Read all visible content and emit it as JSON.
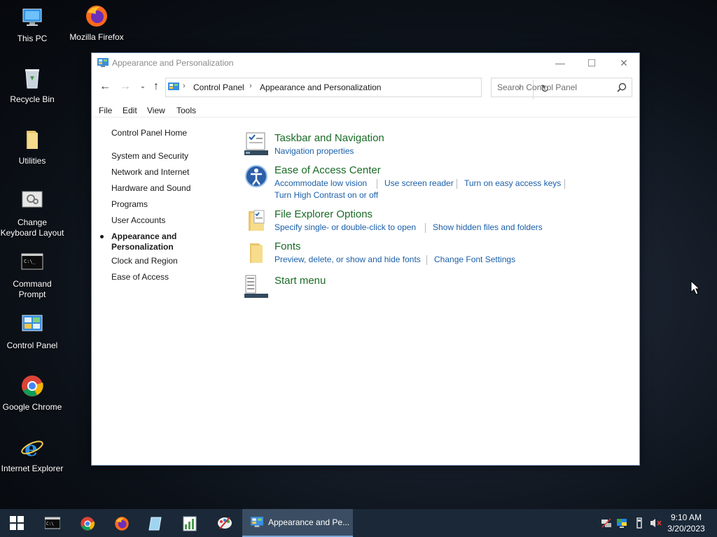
{
  "desktop": {
    "icons": [
      {
        "label": "This PC"
      },
      {
        "label": "Mozilla Firefox"
      },
      {
        "label": "Recycle Bin"
      },
      {
        "label": "Utilities"
      },
      {
        "label": "Change Keyboard Layout"
      },
      {
        "label": "Command Prompt"
      },
      {
        "label": "Control Panel"
      },
      {
        "label": "Google Chrome"
      },
      {
        "label": "Internet Explorer"
      }
    ]
  },
  "window": {
    "title": "Appearance and Personalization",
    "breadcrumb": [
      "Control Panel",
      "Appearance and Personalization"
    ],
    "search_placeholder": "Search Control Panel",
    "menu": [
      "File",
      "Edit",
      "View",
      "Tools"
    ],
    "controls": {
      "minimize": "—",
      "maximize": "☐",
      "close": "✕"
    }
  },
  "left_nav": {
    "home": "Control Panel Home",
    "items": [
      {
        "label": "System and Security"
      },
      {
        "label": "Network and Internet"
      },
      {
        "label": "Hardware and Sound"
      },
      {
        "label": "Programs"
      },
      {
        "label": "User Accounts"
      },
      {
        "label": "Appearance and Personalization",
        "line1": "Appearance and",
        "line2": "Personalization",
        "active": true
      },
      {
        "label": "Clock and Region"
      },
      {
        "label": "Ease of Access"
      }
    ]
  },
  "categories": [
    {
      "title": "Taskbar and Navigation",
      "icon": "taskbar-icon",
      "links": [
        "Navigation properties"
      ]
    },
    {
      "title": "Ease of Access Center",
      "icon": "ease-of-access-icon",
      "links": [
        "Accommodate low vision",
        "Use screen reader",
        "Turn on easy access keys",
        "Turn High Contrast on or off"
      ]
    },
    {
      "title": "File Explorer Options",
      "icon": "folder-options-icon",
      "links": [
        "Specify single- or double-click to open",
        "Show hidden files and folders"
      ]
    },
    {
      "title": "Fonts",
      "icon": "fonts-folder-icon",
      "links": [
        "Preview, delete, or show and hide fonts",
        "Change Font Settings"
      ]
    },
    {
      "title": "Start menu",
      "icon": "start-menu-icon",
      "links": []
    }
  ],
  "taskbar": {
    "active_window_label": "Appearance and Pe...",
    "pinned": [
      "start-icon",
      "command-prompt-icon",
      "chrome-icon",
      "firefox-icon",
      "notepad-icon",
      "spreadsheet-icon",
      "paint-icon"
    ],
    "clock_time": "9:10 AM",
    "clock_date": "3/20/2023"
  },
  "colors": {
    "category_title": "#1a6b26",
    "link": "#1a5fa8",
    "taskbar": "#1a2838"
  }
}
